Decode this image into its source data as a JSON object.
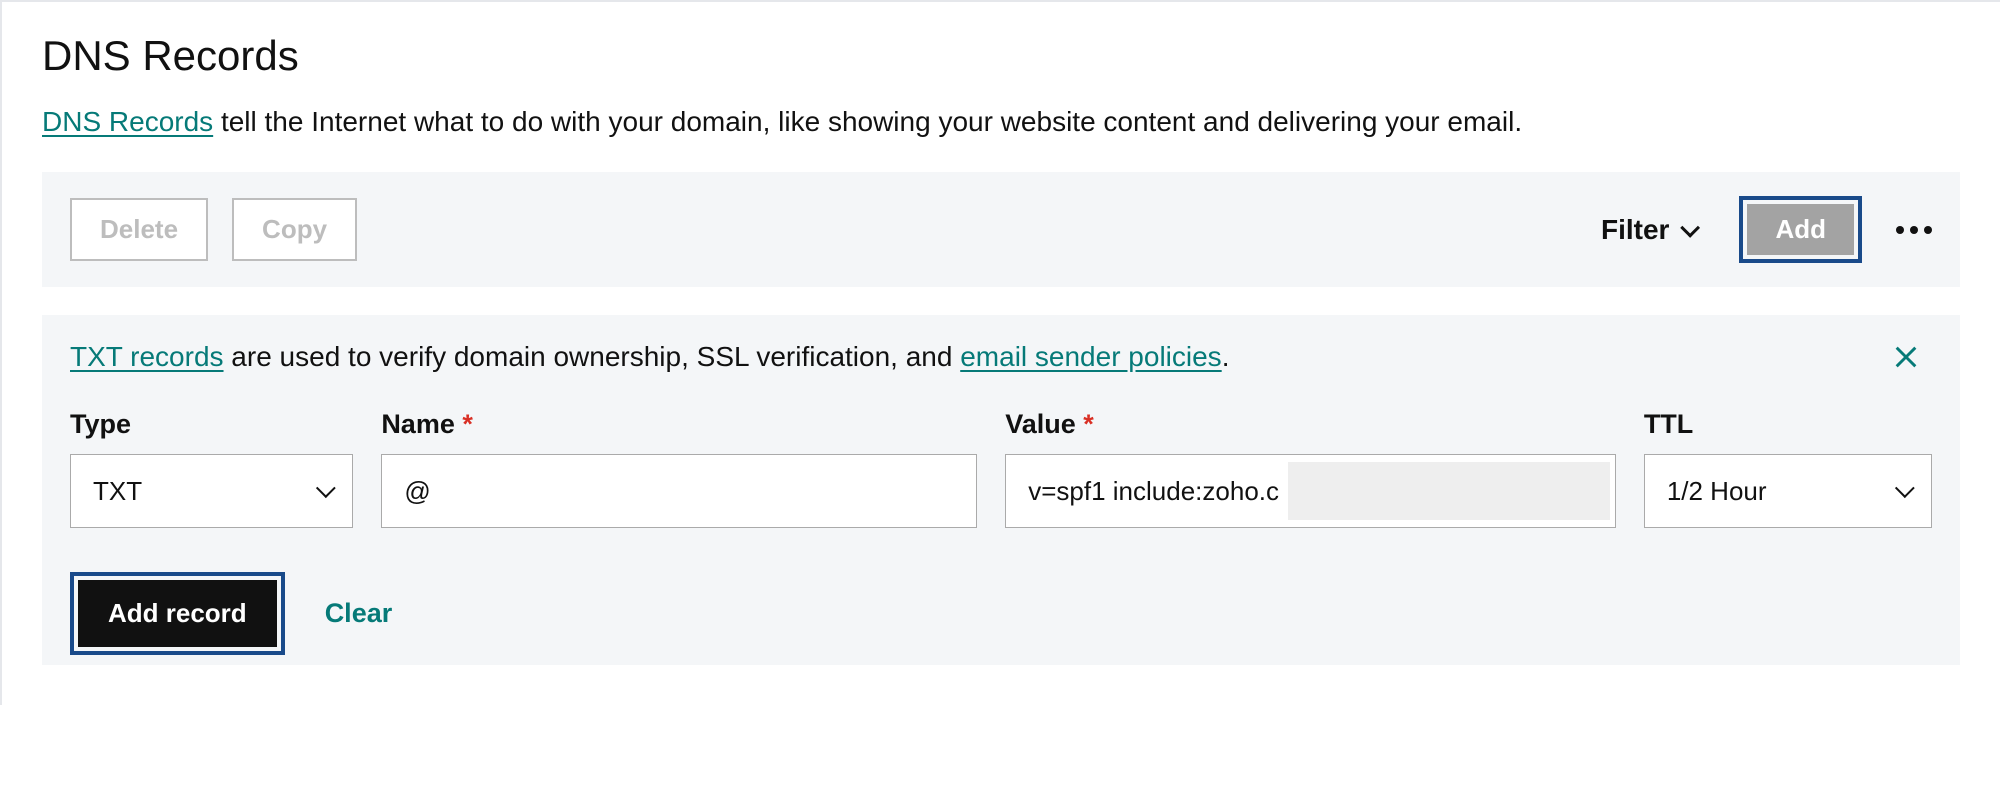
{
  "header": {
    "title": "DNS Records",
    "desc_link": "DNS Records",
    "desc_rest": " tell the Internet what to do with your domain, like showing your website content and delivering your email."
  },
  "toolbar": {
    "delete_label": "Delete",
    "copy_label": "Copy",
    "filter_label": "Filter",
    "add_label": "Add"
  },
  "form": {
    "info_link1": "TXT records",
    "info_mid": " are used to verify domain ownership, SSL verification, and ",
    "info_link2": "email sender policies",
    "info_end": ".",
    "fields": {
      "type": {
        "label": "Type",
        "value": "TXT"
      },
      "name": {
        "label": "Name",
        "required": true,
        "value": "@"
      },
      "value": {
        "label": "Value",
        "required": true,
        "value": "v=spf1 include:zoho.c"
      },
      "ttl": {
        "label": "TTL",
        "value": "1/2 Hour"
      }
    },
    "add_record_label": "Add record",
    "clear_label": "Clear"
  }
}
